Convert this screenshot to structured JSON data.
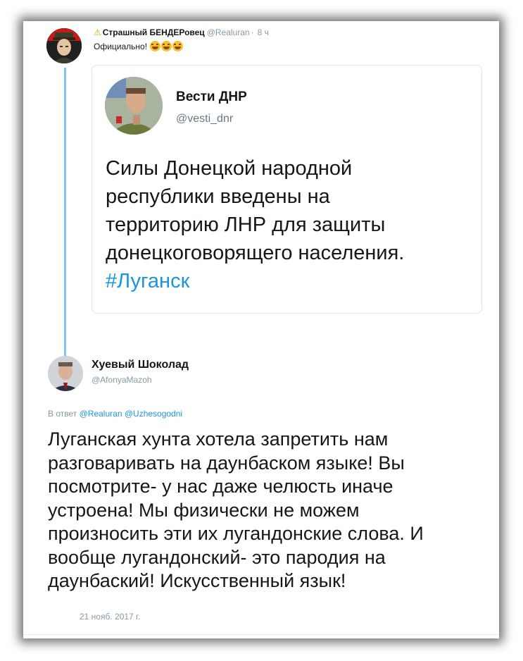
{
  "tweet1": {
    "warn_icon": "warning-icon",
    "name": "Страшный БЕНДЕРовец",
    "handle": "@Realuran",
    "time": "8 ч",
    "text": "Официально!",
    "emoji_count": 3,
    "emoji_icon": "laughing-crying-emoji-icon"
  },
  "quoted": {
    "name": "Вести ДНР",
    "handle": "@vesti_dnr",
    "lines": [
      "Силы Донецкой народной",
      "республики введены на",
      "территорию ЛНР для защиты",
      "донецкоговорящего населения."
    ],
    "hashtag": "#Луганск"
  },
  "tweet2": {
    "name": "Хуевый Шоколад",
    "handle": "@AfonyaMazoh",
    "reply_prefix": "В ответ",
    "reply_mentions": [
      "@Realuran",
      "@Uzhesogodni"
    ],
    "lines": [
      "Луганская хунта хотела запретить нам",
      "разговаривать на даунбаском языке! Вы",
      "посмотрите- у нас даже челюсть иначе",
      "устроена! Мы физически не можем",
      "произносить эти их лугандонские слова. И",
      "вообще лугандонский- это пародия на",
      "даунбаский! Искусственный язык!"
    ],
    "date": "21 нояб. 2017 г."
  },
  "colors": {
    "link": "#1b95e0",
    "thread_line": "#7ec3f1",
    "secondary_text": "#8899a6"
  }
}
